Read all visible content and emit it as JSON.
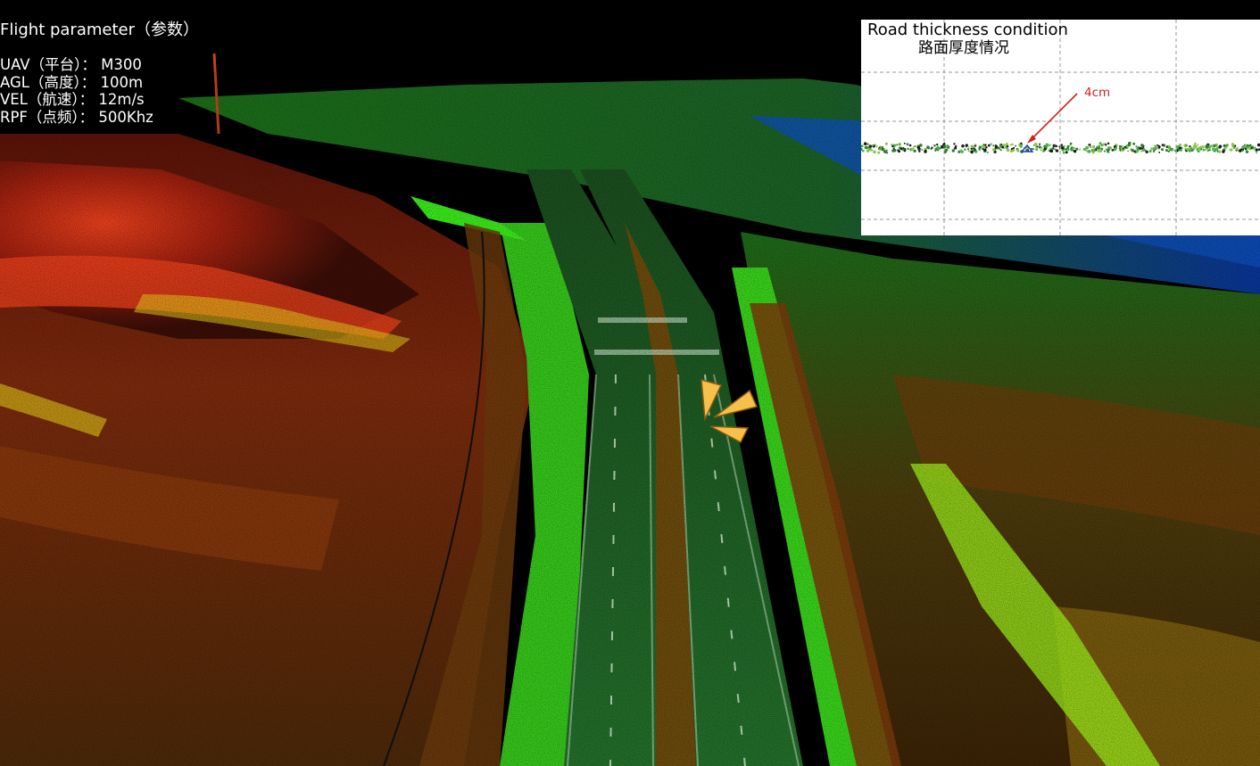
{
  "flight_panel": {
    "title": "Flight parameter（参数）",
    "params": [
      "UAV（平台）： M300",
      "AGL（高度）： 100m",
      "VEL（航速）： 12m/s",
      "RPF（点频）： 500Khz"
    ]
  },
  "inset": {
    "title": "Road thickness condition",
    "subtitle": "路面厚度情况",
    "measurement": "4cm",
    "colors": {
      "background": "#ffffff",
      "grid": "#9a9a9a",
      "arrow": "#d0201a",
      "points": [
        "#1a1a1a",
        "#2e7d32",
        "#4caf50",
        "#8bc34a"
      ]
    }
  },
  "scene": {
    "description_colors": {
      "sky": "#000000",
      "road": "#1f6a2a",
      "grass": "#39e81a",
      "hill_high": "#d8301a",
      "hill_mid": "#8a3a10",
      "water_edge": "#1aa0d8",
      "marker": "#f7c04a"
    }
  }
}
